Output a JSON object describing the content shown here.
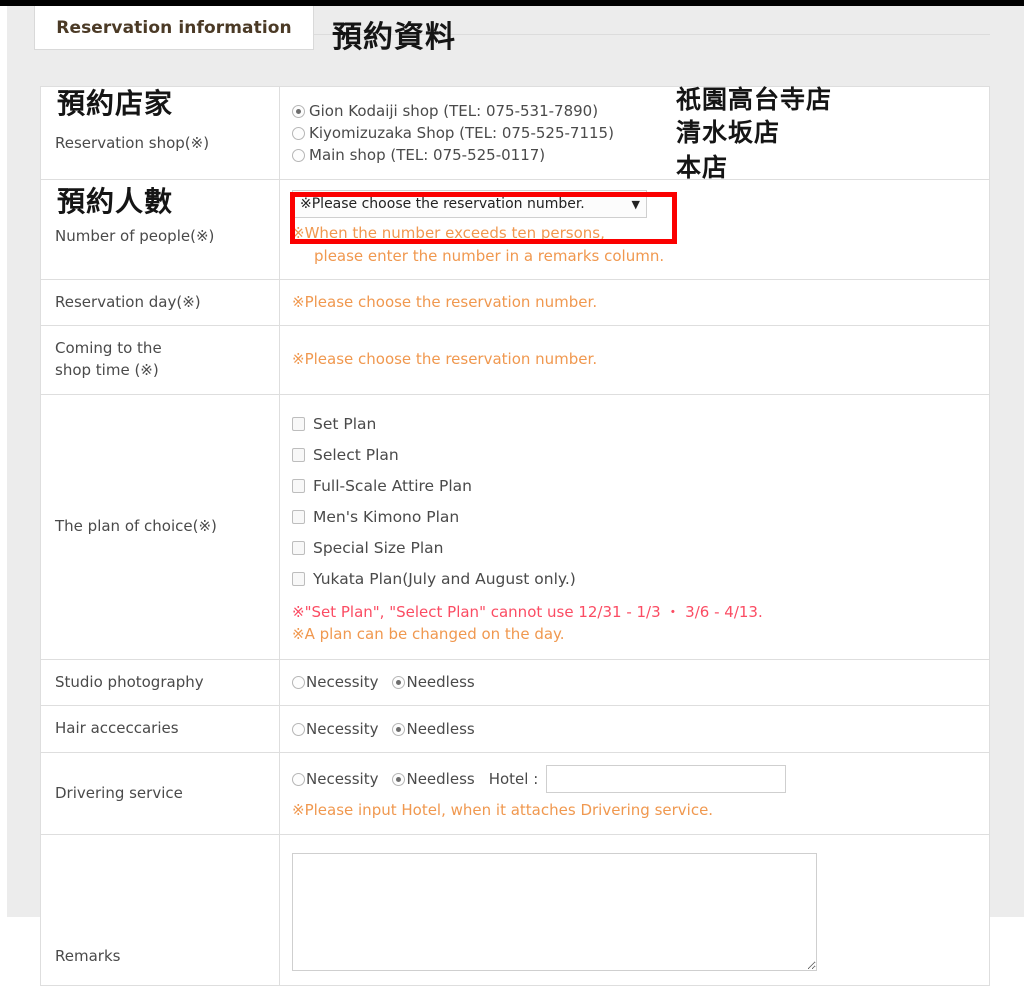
{
  "window": {
    "top_bar_color": "#000000",
    "page_bg_color": "#ececec"
  },
  "tab": {
    "label": "Reservation information",
    "title_annotation_zh": "預約資料"
  },
  "annotations_zh": {
    "reservation_shop": "預約店家",
    "number_of_people": "預約人數",
    "shop_1": "祇園高台寺店",
    "shop_2": "清水坂店",
    "shop_3": "本店",
    "highlight_color": "#fb0000"
  },
  "form": {
    "rows": [
      {
        "id": "reservation-shop",
        "label": "Reservation shop(※)",
        "type": "radio-list",
        "options": [
          {
            "label": "Gion Kodaiji shop (TEL: 075-531-7890)",
            "checked": true
          },
          {
            "label": "Kiyomizuzaka Shop (TEL: 075-525-7115)",
            "checked": false
          },
          {
            "label": "Main shop (TEL: 075-525-0117)",
            "checked": false
          }
        ]
      },
      {
        "id": "number-of-people",
        "label": "Number of people(※)",
        "type": "select",
        "select_value": "※Please choose the reservation number.",
        "caret": "▼",
        "note_lines": [
          "※When the number exceeds ten persons,",
          "please enter the number in a remarks column."
        ]
      },
      {
        "id": "reservation-day",
        "label": "Reservation day(※)",
        "type": "note",
        "note": "※Please choose the reservation number."
      },
      {
        "id": "coming-to-the-shop-time",
        "label": "Coming to the\nshop time (※)",
        "label_line1": "Coming to the",
        "label_line2": "shop time (※)",
        "type": "note",
        "note": "※Please choose the reservation number."
      },
      {
        "id": "plan-of-choice",
        "label": "The plan of choice(※)",
        "type": "checkbox-list",
        "options": [
          {
            "label": "Set Plan",
            "checked": false
          },
          {
            "label": "Select Plan",
            "checked": false
          },
          {
            "label": "Full-Scale Attire Plan",
            "checked": false
          },
          {
            "label": "Men's Kimono Plan",
            "checked": false
          },
          {
            "label": "Special Size Plan",
            "checked": false
          },
          {
            "label": "Yukata Plan(July and August only.)",
            "checked": false
          }
        ],
        "note_red": "※\"Set Plan\", \"Select Plan\" cannot use 12/31 - 1/3 ・ 3/6 - 4/13.",
        "note_orange": "※A plan can be changed on the day."
      },
      {
        "id": "studio-photography",
        "label": "Studio photography",
        "type": "radio-pair",
        "option_1": "Necessity",
        "option_2": "Needless",
        "checked_index": 2
      },
      {
        "id": "hair-acceccaries",
        "label": "Hair acceccaries",
        "type": "radio-pair",
        "option_1": "Necessity",
        "option_2": "Needless",
        "checked_index": 2
      },
      {
        "id": "drivering-service",
        "label": "Drivering service",
        "type": "radio-pair-with-input",
        "option_1": "Necessity",
        "option_2": "Needless",
        "checked_index": 2,
        "hotel_label": "Hotel :",
        "hotel_value": "",
        "note": "※Please input Hotel, when it attaches Drivering service."
      },
      {
        "id": "remarks",
        "label": "Remarks",
        "type": "textarea",
        "value": ""
      }
    ]
  },
  "colors": {
    "note_orange": "#f0984f",
    "note_red": "#fb4c63",
    "tab_text": "#4b3a26",
    "label_text": "#4a4a4a",
    "border": "#dedede"
  }
}
